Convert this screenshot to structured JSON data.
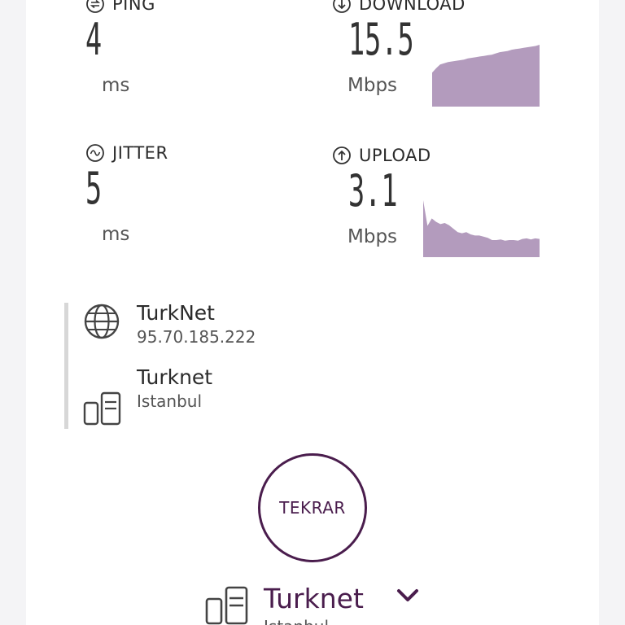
{
  "metrics": {
    "ping": {
      "label": "PING",
      "value": "4",
      "unit": "ms",
      "icon": "ping-icon"
    },
    "jitter": {
      "label": "JITTER",
      "value": "5",
      "unit": "ms",
      "icon": "jitter-icon"
    },
    "download": {
      "label": "DOWNLOAD",
      "value": "15.5",
      "unit": "Mbps",
      "icon": "download-arrow-icon",
      "samples": [
        0.55,
        0.62,
        0.68,
        0.7,
        0.72,
        0.73,
        0.74,
        0.75,
        0.76,
        0.78,
        0.79,
        0.8,
        0.81,
        0.82,
        0.83,
        0.84,
        0.86,
        0.88,
        0.89,
        0.9,
        0.92,
        0.93,
        0.94,
        0.95,
        0.96,
        0.97,
        0.98,
        1.0
      ]
    },
    "upload": {
      "label": "UPLOAD",
      "value": "3.1",
      "unit": "Mbps",
      "icon": "upload-arrow-icon",
      "samples": [
        1.0,
        0.55,
        0.68,
        0.62,
        0.58,
        0.6,
        0.56,
        0.5,
        0.44,
        0.42,
        0.44,
        0.4,
        0.38,
        0.38,
        0.36,
        0.34,
        0.3,
        0.3,
        0.31,
        0.29,
        0.3,
        0.3,
        0.29,
        0.32,
        0.33,
        0.31,
        0.33,
        0.32
      ]
    }
  },
  "connection": {
    "isp": {
      "name": "TurkNet",
      "ip": "95.70.185.222",
      "icon": "globe-icon"
    },
    "server": {
      "name": "Turknet",
      "location": "Istanbul",
      "icon": "server-icon"
    }
  },
  "retry_label": "TEKRAR",
  "bottom_server": {
    "name": "Turknet",
    "location": "Istanbul"
  },
  "colors": {
    "accent": "#4a1d4d",
    "chart_fill": "#b39bbd",
    "divider": "#d7d7d7"
  }
}
